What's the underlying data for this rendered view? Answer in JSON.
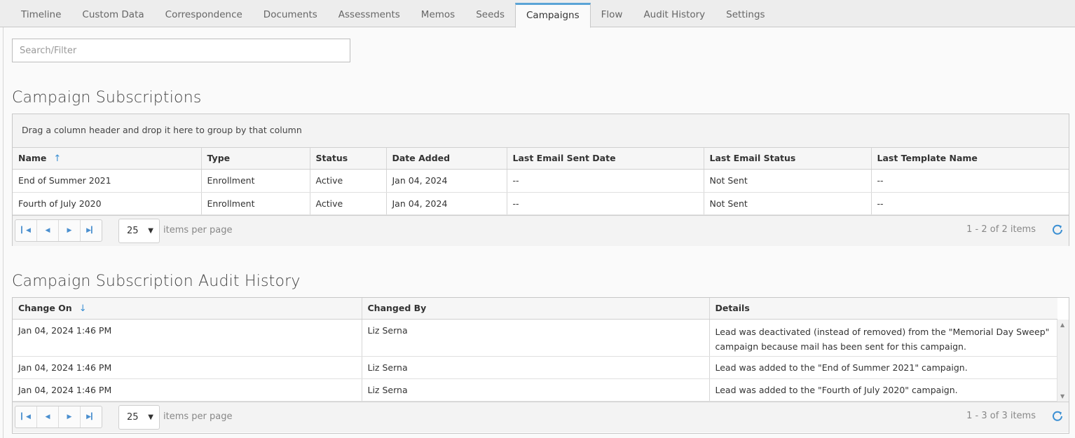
{
  "tabs": [
    {
      "label": "Timeline"
    },
    {
      "label": "Custom Data"
    },
    {
      "label": "Correspondence"
    },
    {
      "label": "Documents"
    },
    {
      "label": "Assessments"
    },
    {
      "label": "Memos"
    },
    {
      "label": "Seeds"
    },
    {
      "label": "Campaigns",
      "active": true
    },
    {
      "label": "Flow"
    },
    {
      "label": "Audit History"
    },
    {
      "label": "Settings"
    }
  ],
  "search": {
    "placeholder": "Search/Filter",
    "value": ""
  },
  "subscriptions": {
    "title": "Campaign Subscriptions",
    "group_hint": "Drag a column header and drop it here to group by that column",
    "columns": [
      "Name",
      "Type",
      "Status",
      "Date Added",
      "Last Email Sent Date",
      "Last Email Status",
      "Last Template Name"
    ],
    "sort_icon": "arrow-up-icon",
    "rows": [
      [
        "End of Summer 2021",
        "Enrollment",
        "Active",
        "Jan 04, 2024",
        "--",
        "Not Sent",
        "--"
      ],
      [
        "Fourth of July 2020",
        "Enrollment",
        "Active",
        "Jan 04, 2024",
        "--",
        "Not Sent",
        "--"
      ]
    ],
    "pager": {
      "page_size": "25",
      "items_per_page": "items per page",
      "info": "1 - 2 of 2 items"
    }
  },
  "audit": {
    "title": "Campaign Subscription Audit History",
    "columns": [
      "Change On",
      "Changed By",
      "Details"
    ],
    "sort_icon": "arrow-down-icon",
    "rows": [
      [
        "Jan 04, 2024 1:46 PM",
        "Liz Serna",
        "Lead was deactivated (instead of removed) from the \"Memorial Day Sweep\"",
        "campaign because mail has been sent for this campaign."
      ],
      [
        "Jan 04, 2024 1:46 PM",
        "Liz Serna",
        "Lead was added to the \"End of Summer 2021\" campaign."
      ],
      [
        "Jan 04, 2024 1:46 PM",
        "Liz Serna",
        "Lead was added to the \"Fourth of July 2020\" campaign."
      ]
    ],
    "pager": {
      "page_size": "25",
      "items_per_page": "items per page",
      "info": "1 - 3 of 3 items"
    }
  },
  "colors": {
    "accent": "#5aa4d6",
    "link": "#3a8fd3"
  }
}
